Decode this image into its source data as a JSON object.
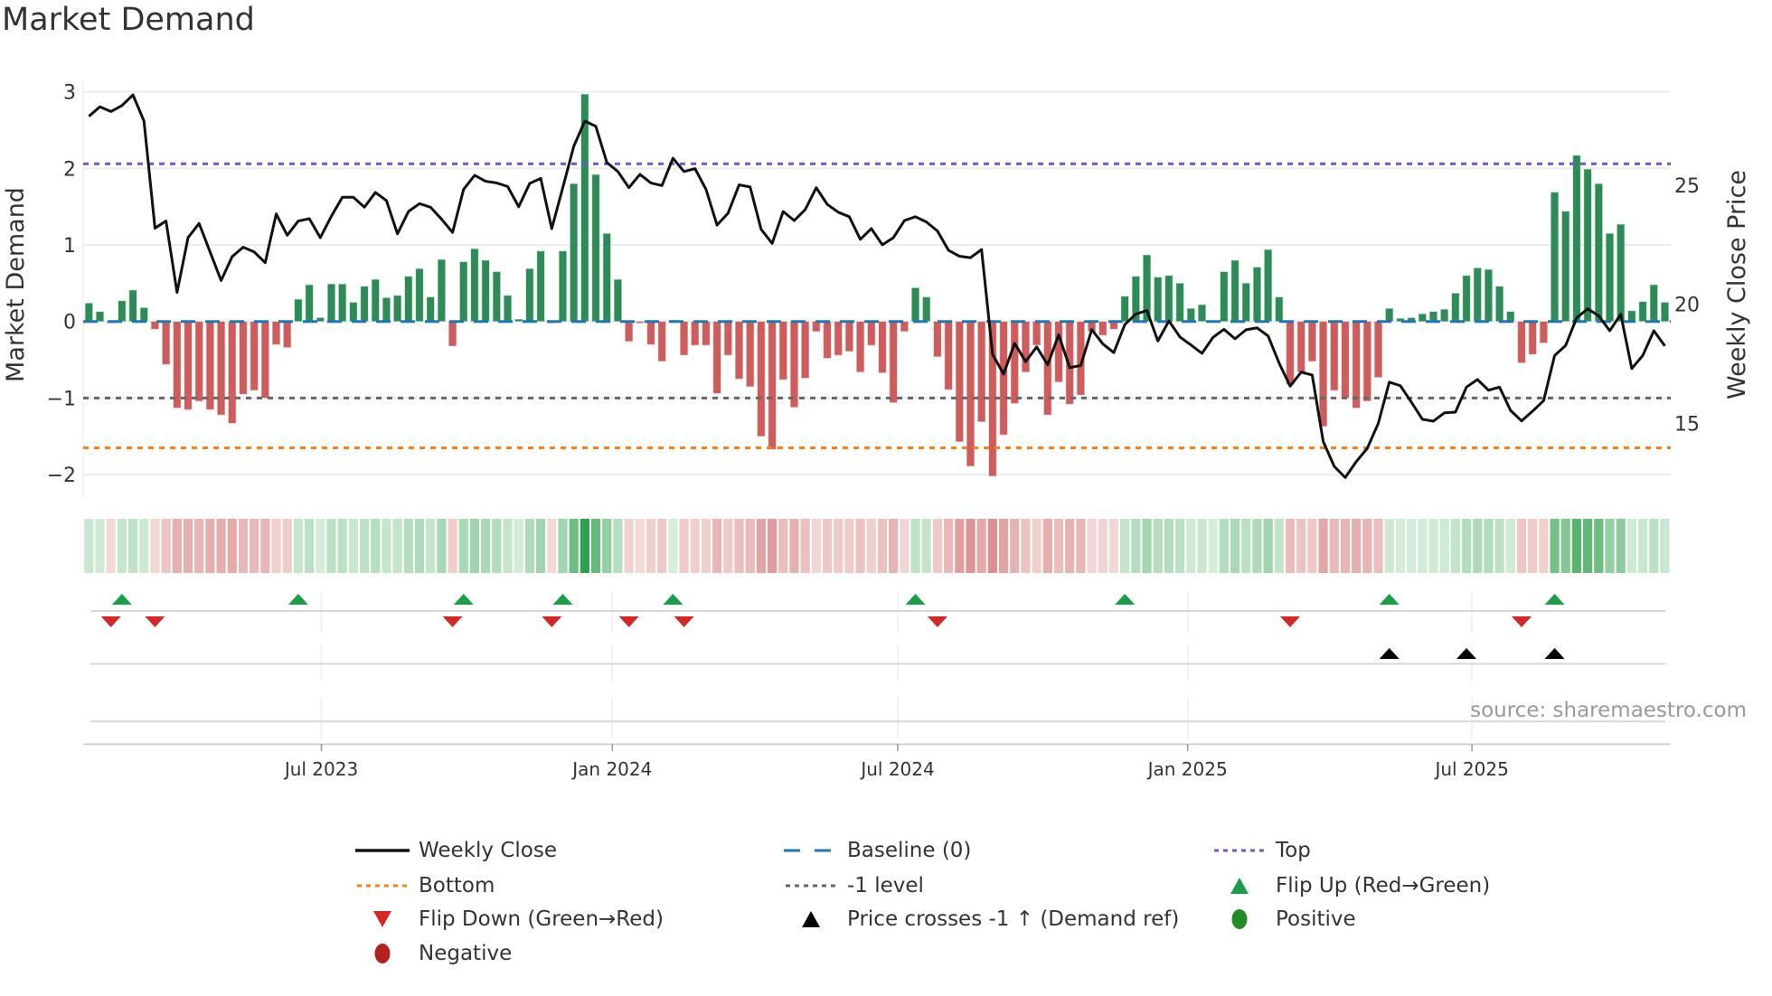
{
  "title": "Market Demand",
  "source": "source: sharemaestro.com",
  "colors": {
    "positive_bar": "#2e8b57",
    "negative_bar": "#cd5c5c",
    "price_line": "#111111",
    "baseline": "#1f77b4",
    "top": "#6a5acd",
    "bottom": "#ff7f0e",
    "minus_one": "#666666",
    "flip_up": "#1a9e48",
    "flip_down": "#d62728",
    "price_cross": "#000000",
    "positive_dot": "#228b22",
    "negative_dot": "#b22222"
  },
  "chart_data": {
    "type": "bar",
    "title": "Market Demand",
    "ylabel": "Market Demand",
    "y2label": "Weekly Close Price",
    "ylim": [
      -2.25,
      3.2
    ],
    "y2lim": [
      12.3,
      29.6
    ],
    "yticks": [
      3,
      2,
      1,
      0,
      -1,
      -2
    ],
    "ytick_labels": [
      "3",
      "2",
      "1",
      "0",
      "−1",
      "−2"
    ],
    "y2ticks": [
      25,
      20,
      15
    ],
    "y2tick_labels": [
      "25",
      "20",
      "15"
    ],
    "x_unit": "week index",
    "x_ticks": [
      {
        "label": "Jul 2023",
        "week": 21.1
      },
      {
        "label": "Jan 2024",
        "week": 47.5
      },
      {
        "label": "Jul 2024",
        "week": 73.4
      },
      {
        "label": "Jan 2025",
        "week": 99.7
      },
      {
        "label": "Jul 2025",
        "week": 125.5
      }
    ],
    "reference_lines": {
      "top": 2.06,
      "baseline": 0,
      "minus_one": -1,
      "bottom": -1.65
    },
    "series": [
      {
        "name": "Market Demand",
        "kind": "bar",
        "values": [
          0.24,
          0.13,
          -0.02,
          0.27,
          0.41,
          0.18,
          -0.1,
          -0.56,
          -1.13,
          -1.15,
          -1.04,
          -1.15,
          -1.22,
          -1.33,
          -0.95,
          -0.9,
          -1.0,
          -0.3,
          -0.34,
          0.29,
          0.48,
          0.05,
          0.49,
          0.49,
          0.25,
          0.46,
          0.55,
          0.31,
          0.34,
          0.59,
          0.69,
          0.32,
          0.81,
          -0.32,
          0.78,
          0.95,
          0.8,
          0.65,
          0.34,
          0.03,
          0.69,
          0.92,
          -0.02,
          0.92,
          1.8,
          2.97,
          1.92,
          1.15,
          0.55,
          -0.26,
          -0.02,
          -0.3,
          -0.52,
          0.02,
          -0.44,
          -0.31,
          -0.31,
          -0.94,
          -0.44,
          -0.75,
          -0.85,
          -1.5,
          -1.67,
          -0.76,
          -1.12,
          -0.74,
          -0.13,
          -0.48,
          -0.44,
          -0.39,
          -0.66,
          -0.31,
          -0.67,
          -1.06,
          -0.13,
          0.44,
          0.32,
          -0.46,
          -0.89,
          -1.57,
          -1.89,
          -1.31,
          -2.02,
          -1.48,
          -1.07,
          -0.66,
          -0.31,
          -1.22,
          -0.79,
          -1.08,
          -0.96,
          -0.13,
          -0.18,
          -0.1,
          0.33,
          0.59,
          0.87,
          0.58,
          0.6,
          0.5,
          0.17,
          0.22,
          0.01,
          0.65,
          0.8,
          0.5,
          0.71,
          0.94,
          0.32,
          -0.82,
          -0.66,
          -0.52,
          -1.37,
          -0.9,
          -1.0,
          -1.13,
          -1.04,
          -0.73,
          0.17,
          0.04,
          0.05,
          0.1,
          0.13,
          0.16,
          0.37,
          0.6,
          0.7,
          0.68,
          0.46,
          0.13,
          -0.54,
          -0.43,
          -0.28,
          1.69,
          1.44,
          2.17,
          1.99,
          1.8,
          1.15,
          1.27,
          0.14,
          0.26,
          0.48,
          0.25
        ]
      },
      {
        "name": "Weekly Close",
        "kind": "line",
        "axis": "right",
        "values": [
          27.9,
          28.3,
          28.1,
          28.35,
          28.8,
          27.7,
          23.2,
          23.5,
          20.5,
          22.8,
          23.4,
          22.2,
          21.0,
          22.0,
          22.4,
          22.2,
          21.75,
          23.8,
          22.9,
          23.5,
          23.6,
          22.8,
          23.7,
          24.5,
          24.5,
          24.08,
          24.7,
          24.36,
          22.96,
          23.9,
          24.23,
          24.08,
          23.58,
          23.02,
          24.83,
          25.42,
          25.17,
          25.1,
          24.95,
          24.1,
          25.08,
          25.29,
          23.18,
          24.9,
          26.64,
          27.7,
          27.48,
          25.96,
          25.58,
          24.9,
          25.46,
          25.1,
          24.99,
          26.14,
          25.58,
          25.7,
          24.83,
          23.33,
          23.83,
          25.02,
          24.93,
          23.15,
          22.56,
          23.9,
          23.52,
          23.98,
          24.9,
          24.2,
          23.87,
          23.68,
          22.73,
          23.18,
          22.5,
          22.8,
          23.52,
          23.68,
          23.46,
          23.08,
          22.27,
          22.02,
          21.96,
          22.3,
          17.9,
          17.07,
          18.36,
          17.59,
          18.21,
          17.46,
          18.72,
          17.34,
          17.43,
          18.94,
          18.34,
          17.97,
          19.15,
          19.59,
          19.74,
          18.46,
          19.3,
          18.63,
          18.29,
          17.94,
          18.61,
          18.95,
          18.55,
          18.93,
          19.01,
          18.67,
          17.53,
          16.56,
          17.15,
          17.03,
          14.24,
          13.19,
          12.72,
          13.39,
          13.95,
          15.0,
          16.73,
          16.58,
          15.89,
          15.17,
          15.09,
          15.44,
          15.47,
          16.52,
          16.84,
          16.39,
          16.52,
          15.54,
          15.1,
          15.51,
          15.95,
          17.85,
          18.27,
          19.43,
          19.81,
          19.52,
          18.89,
          19.58,
          17.3,
          17.85,
          18.89,
          18.25
        ]
      }
    ],
    "events": {
      "flip_up_weeks": [
        3,
        19,
        34,
        43,
        53,
        75,
        94,
        118,
        133
      ],
      "flip_down_weeks": [
        2,
        6,
        33,
        42,
        49,
        54,
        77,
        109,
        130
      ],
      "price_cross_weeks": [
        118,
        125,
        133
      ]
    },
    "legend_position": "bottom",
    "grid": true
  },
  "legend": [
    {
      "label": "Weekly Close",
      "kind": "line-solid",
      "color_key": "price_line"
    },
    {
      "label": "Baseline (0)",
      "kind": "line-dash",
      "color_key": "baseline"
    },
    {
      "label": "Top",
      "kind": "line-dot",
      "color_key": "top"
    },
    {
      "label": "Bottom",
      "kind": "line-dot",
      "color_key": "bottom"
    },
    {
      "label": "-1 level",
      "kind": "line-dot",
      "color_key": "minus_one"
    },
    {
      "label": "Flip Up (Red→Green)",
      "kind": "tri-up",
      "color_key": "flip_up"
    },
    {
      "label": "Flip Down (Green→Red)",
      "kind": "tri-down",
      "color_key": "flip_down"
    },
    {
      "label": "Price crosses -1 ↑ (Demand ref)",
      "kind": "tri-up",
      "color_key": "price_cross"
    },
    {
      "label": "Positive",
      "kind": "dot",
      "color_key": "positive_dot"
    },
    {
      "label": "Negative",
      "kind": "dot",
      "color_key": "negative_dot"
    }
  ]
}
